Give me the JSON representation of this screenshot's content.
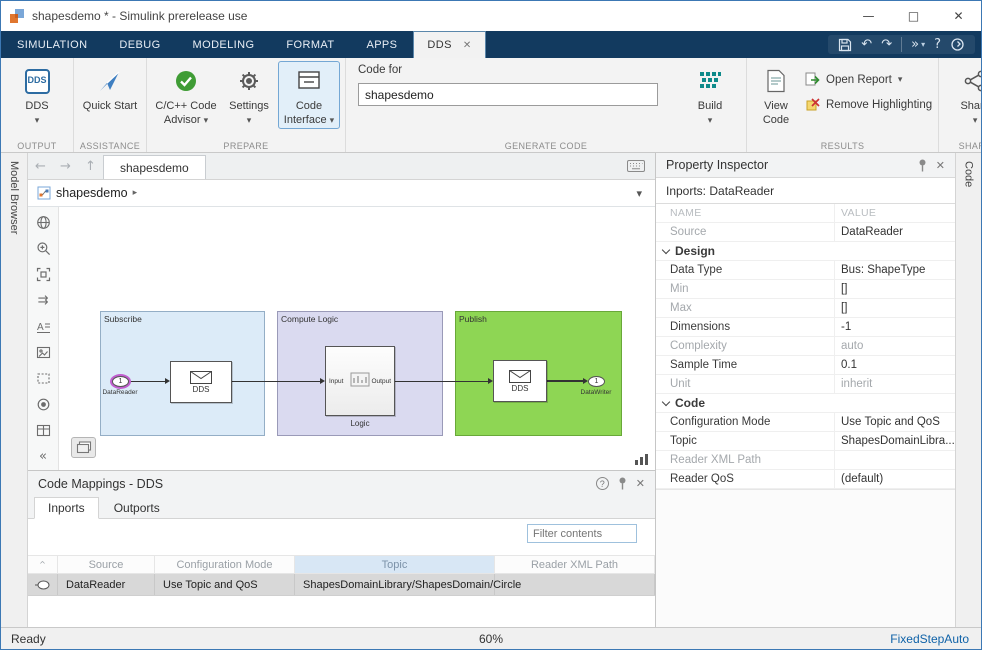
{
  "window": {
    "title": "shapesdemo * - Simulink prerelease use"
  },
  "icons": {
    "minimize": "—",
    "maximize": "□",
    "close": "✕",
    "tab_close": "✕",
    "dropdown": "▾",
    "undo": "↶",
    "redo": "↷",
    "overflow": "»",
    "help": "?",
    "back": "←",
    "forward": "→",
    "up": "↑",
    "collapse": "«",
    "breadcrumb_arrow": "▸",
    "breadcrumb_caret": "▾",
    "question": "?",
    "sort": "^",
    "route": "⇉"
  },
  "tabs": {
    "simulation": "SIMULATION",
    "debug": "DEBUG",
    "modeling": "MODELING",
    "format": "FORMAT",
    "apps": "APPS",
    "dds": "DDS"
  },
  "ribbon": {
    "output": {
      "section": "OUTPUT",
      "dds_icon": "DDS",
      "dds_label": "DDS"
    },
    "assistance": {
      "section": "ASSISTANCE",
      "quick_start": "Quick Start"
    },
    "prepare": {
      "section": "PREPARE",
      "advisor": "C/C++ Code Advisor",
      "settings": "Settings",
      "code_interface": "Code Interface"
    },
    "generate": {
      "section": "GENERATE CODE",
      "code_for": "Code for",
      "model_name": "shapesdemo",
      "build": "Build"
    },
    "results": {
      "section": "RESULTS",
      "view_code": "View Code",
      "open_report": "Open Report",
      "remove_highlighting": "Remove Highlighting"
    },
    "share": {
      "section": "SHARE",
      "share": "Share"
    }
  },
  "model_browser_label": "Model Browser",
  "code_pane_label": "Code",
  "doc": {
    "tab": "shapesdemo",
    "breadcrumb": "shapesdemo"
  },
  "canvas": {
    "subscribe": {
      "label": "Subscribe",
      "port_num": "1",
      "port_label": "DataReader",
      "block_label": "DDS"
    },
    "compute": {
      "label": "Compute Logic",
      "input": "Input",
      "output": "Output",
      "block_label": "Logic"
    },
    "publish": {
      "label": "Publish",
      "block_label": "DDS",
      "port_num": "1",
      "port_label": "DataWriter"
    }
  },
  "mappings": {
    "title": "Code Mappings - DDS",
    "tabs": {
      "inports": "Inports",
      "outports": "Outports"
    },
    "filter_placeholder": "Filter contents",
    "columns": {
      "source": "Source",
      "mode": "Configuration Mode",
      "topic": "Topic",
      "xml": "Reader XML Path"
    },
    "row": {
      "source": "DataReader",
      "mode": "Use Topic and QoS",
      "topic": "ShapesDomainLibrary/ShapesDomain/Circle",
      "xml": ""
    }
  },
  "inspector": {
    "title": "Property Inspector",
    "subtitle": "Inports: DataReader",
    "name_header": "NAME",
    "value_header": "VALUE",
    "source": {
      "name": "Source",
      "value": "DataReader"
    },
    "design_section": "Design",
    "design": [
      {
        "name": "Data Type",
        "value": "Bus: ShapeType"
      },
      {
        "name": "Min",
        "value": "[]"
      },
      {
        "name": "Max",
        "value": "[]"
      },
      {
        "name": "Dimensions",
        "value": "-1"
      },
      {
        "name": "Complexity",
        "value": "auto"
      },
      {
        "name": "Sample Time",
        "value": "0.1"
      },
      {
        "name": "Unit",
        "value": "inherit"
      }
    ],
    "code_section": "Code",
    "code": [
      {
        "name": "Configuration Mode",
        "value": "Use Topic and QoS"
      },
      {
        "name": "Topic",
        "value": "ShapesDomainLibra..."
      },
      {
        "name": "Reader XML Path",
        "value": ""
      },
      {
        "name": "Reader QoS",
        "value": "(default)"
      }
    ]
  },
  "status": {
    "ready": "Ready",
    "zoom": "60%",
    "solver": "FixedStepAuto"
  },
  "colors": {
    "tabbar_blue": "#123a5f",
    "accent_blue": "#2d6ca2",
    "subscribe_blue": "#dcebf8",
    "compute_purple": "#dadaf0",
    "publish_green": "#8ed654",
    "selection_magenta": "#c15fd0",
    "solver_link_blue": "#0f62a8"
  }
}
